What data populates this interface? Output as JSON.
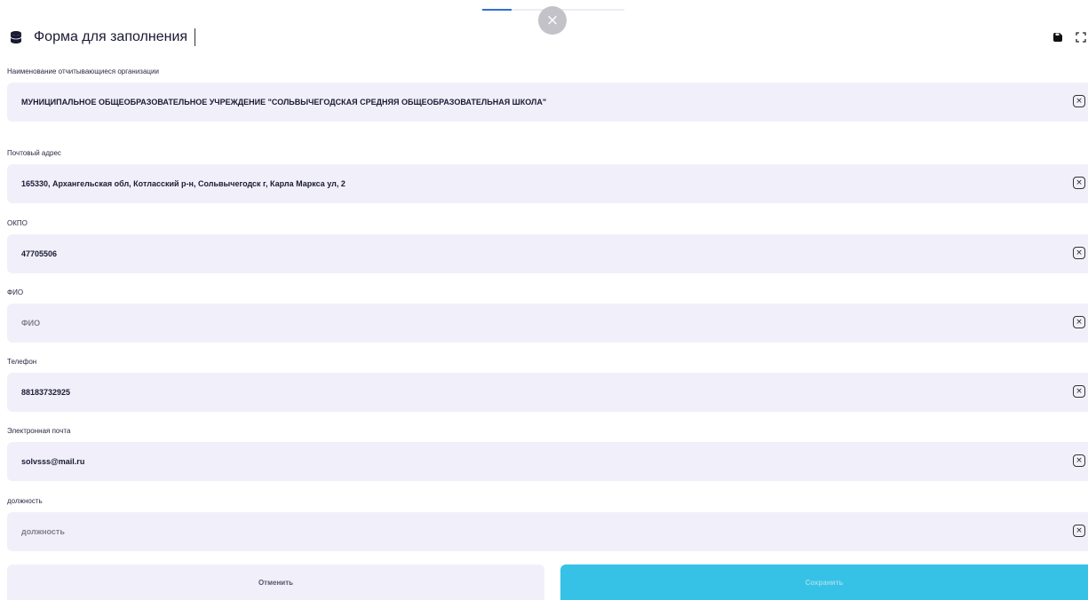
{
  "header": {
    "title": "Форма для заполнения",
    "close_symbol": "×"
  },
  "form": {
    "fields": [
      {
        "label": "Наименование отчитывающиеся организации",
        "value": "МУНИЦИПАЛЬНОЕ ОБЩЕОБРАЗОВАТЕЛЬНОЕ УЧРЕЖДЕНИЕ \"СОЛЬВЫЧЕГОДСКАЯ СРЕДНЯЯ ОБЩЕОБРАЗОВАТЕЛЬНАЯ ШКОЛА\"",
        "placeholder": ""
      },
      {
        "label": "Почтовый адрес",
        "value": "165330, Архангельская обл, Котласский р-н, Сольвычегодск г, Карла Маркса ул, 2",
        "placeholder": ""
      },
      {
        "label": "ОКПО",
        "value": "47705506",
        "placeholder": ""
      },
      {
        "label": "ФИО",
        "value": "",
        "placeholder": "ФИО"
      },
      {
        "label": "Телефон",
        "value": "88183732925",
        "placeholder": ""
      },
      {
        "label": "Электронная почта",
        "value": "solvsss@mail.ru",
        "placeholder": ""
      },
      {
        "label": "должность",
        "value": "",
        "placeholder": "должность"
      }
    ],
    "clear_symbol": "×"
  },
  "buttons": {
    "cancel": "Отменить",
    "save": "Сохранить"
  },
  "colors": {
    "field_bg": "#f1f0fa",
    "save_bg": "#35c2e6",
    "progress": "#2f6fd6"
  },
  "icons": {
    "header_left": "database-icon",
    "header_right": [
      "save-disk-icon",
      "fullscreen-icon"
    ],
    "field_action": "clear-icon",
    "top": "close-icon"
  }
}
